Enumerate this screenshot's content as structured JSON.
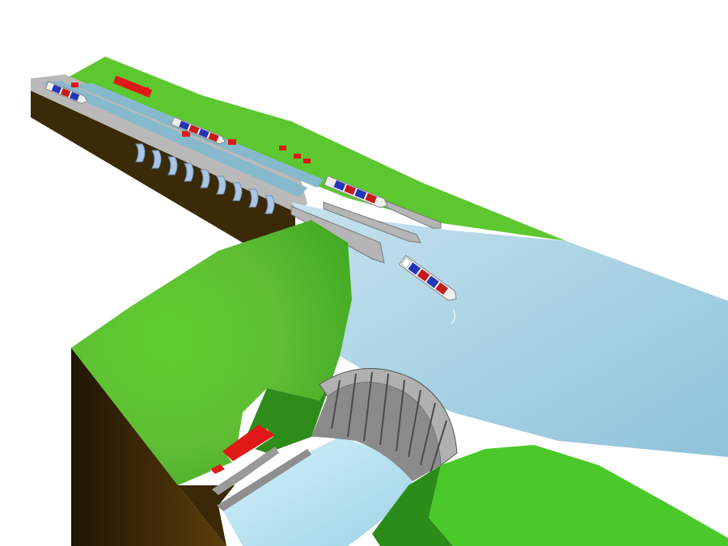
{
  "scene": {
    "subject": "lock-and-dam-render",
    "background": "#ffffff"
  },
  "colors": {
    "grass": "#4fd02a",
    "grass_dark": "#2f9e1c",
    "soil": "#6e4a10",
    "soil_dark": "#2a1c06",
    "water": "#a9d4e6",
    "water_light": "#c9ecf7",
    "concrete": "#a7a7a7",
    "concrete_dark": "#6f6f6f",
    "lock_water": "#86b9cc",
    "roof_red": "#e01818",
    "hull": "#eeeeee",
    "container_blue": "#2436b8",
    "container_red": "#c41c1c"
  }
}
